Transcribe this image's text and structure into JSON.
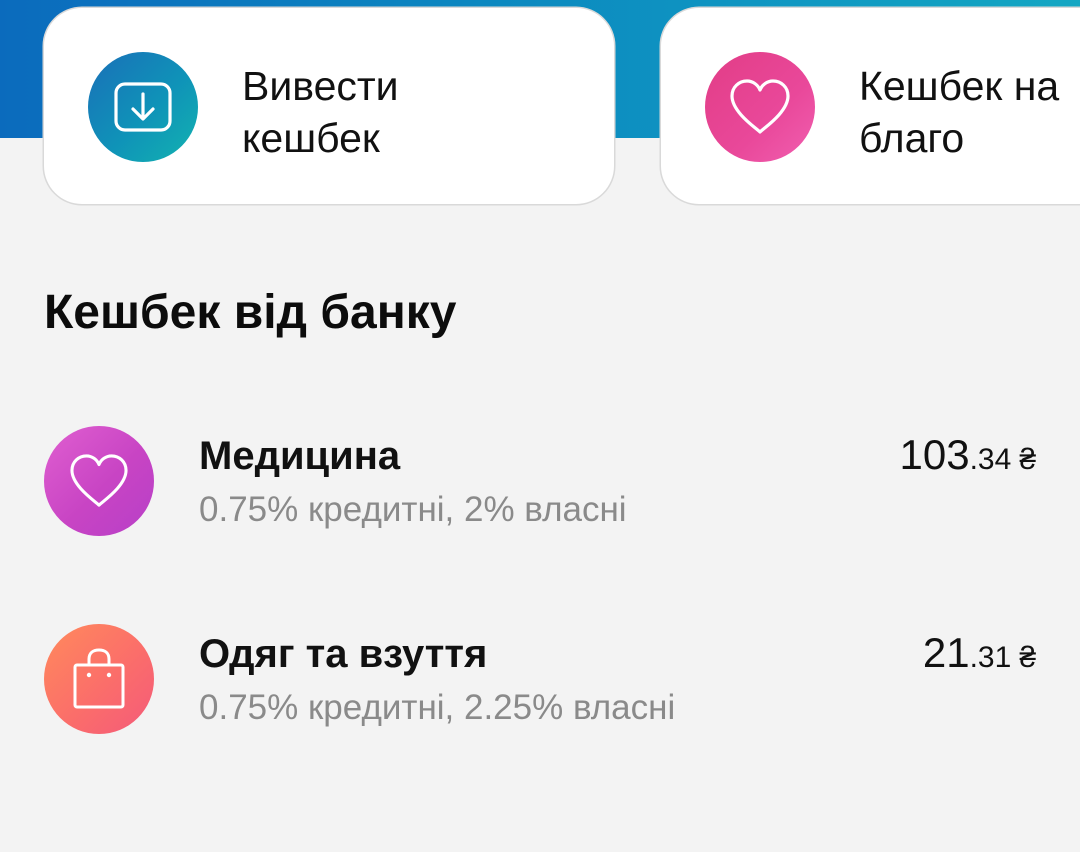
{
  "colors": {
    "header_gradient_start": "#0b6bbd",
    "header_gradient_end": "#14a7c3",
    "withdraw_icon": "#0f93b8",
    "charity_icon": "#e9489a",
    "medicine_icon": "#c844c4",
    "clothes_icon": "#fb6e6a",
    "subtitle_text": "#8a8a8a",
    "background": "#f3f3f3"
  },
  "actions": {
    "withdraw": {
      "label": "Вивести\nкешбек",
      "icon": "download-icon"
    },
    "charity": {
      "label": "Кешбек на\nблаго",
      "icon": "heart-icon"
    }
  },
  "section": {
    "title": "Кешбек від банку"
  },
  "categories": [
    {
      "name": "Медицина",
      "rates": "0.75% кредитні, 2% власні",
      "amount_int": "103",
      "amount_frac": ".34",
      "currency": "₴",
      "icon": "heart-icon"
    },
    {
      "name": "Одяг та взуття",
      "rates": "0.75% кредитні, 2.25% власні",
      "amount_int": "21",
      "amount_frac": ".31",
      "currency": "₴",
      "icon": "shopping-bag-icon"
    }
  ]
}
